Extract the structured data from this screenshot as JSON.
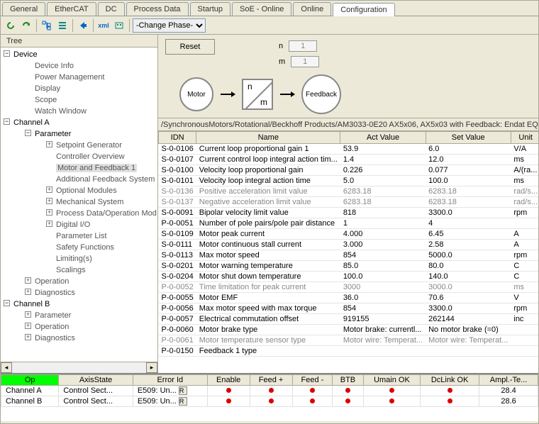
{
  "tabs": [
    "General",
    "EtherCAT",
    "DC",
    "Process Data",
    "Startup",
    "SoE - Online",
    "Online",
    "Configuration"
  ],
  "active_tab": 7,
  "toolbar": {
    "phase_label": "-Change Phase-"
  },
  "tree_title": "Tree",
  "tree": {
    "device": "Device",
    "device_children": [
      "Device Info",
      "Power Management",
      "Display",
      "Scope",
      "Watch Window"
    ],
    "channelA": "Channel A",
    "parameter": "Parameter",
    "param_children": [
      "Setpoint Generator",
      "Controller Overview",
      "Motor and Feedback 1",
      "Additional Feedback System",
      "Optional Modules",
      "Mechanical System",
      "Process Data/Operation Mod",
      "Digital I/O",
      "Parameter List",
      "Safety Functions",
      "Limiting(s)",
      "Scalings"
    ],
    "operation": "Operation",
    "diagnostics": "Diagnostics",
    "channelB": "Channel B",
    "chB_children": [
      "Parameter",
      "Operation",
      "Diagnostics"
    ]
  },
  "right_top": {
    "reset": "Reset",
    "n_label": "n",
    "n_val": "1",
    "m_label": "m",
    "m_val": "1",
    "motor": "Motor",
    "feedback": "Feedback"
  },
  "path": "/SynchronousMotors/Rotational/Beckhoff Products/AM3033-0E20 AX5x06, AX5x03 with Feedback: Endat EQN1125",
  "cols": [
    "IDN",
    "Name",
    "Act Value",
    "Set Value",
    "Unit"
  ],
  "rows": [
    {
      "id": "S-0-0106",
      "name": "Current loop proportional gain 1",
      "act": "53.9",
      "set": "6.0",
      "unit": "V/A",
      "g": 0
    },
    {
      "id": "S-0-0107",
      "name": "Current control loop integral action tim...",
      "act": "1.4",
      "set": "12.0",
      "unit": "ms",
      "g": 0
    },
    {
      "id": "S-0-0100",
      "name": "Velocity loop proportional gain",
      "act": "0.226",
      "set": "0.077",
      "unit": "A/(ra...",
      "g": 0
    },
    {
      "id": "S-0-0101",
      "name": "Velocity loop integral action time",
      "act": "5.0",
      "set": "100.0",
      "unit": "ms",
      "g": 0
    },
    {
      "id": "S-0-0136",
      "name": "Positive acceleration limit value",
      "act": "6283.18",
      "set": "6283.18",
      "unit": "rad/s...",
      "g": 1
    },
    {
      "id": "S-0-0137",
      "name": "Negative acceleration limit value",
      "act": "6283.18",
      "set": "6283.18",
      "unit": "rad/s...",
      "g": 1
    },
    {
      "id": "S-0-0091",
      "name": "Bipolar velocity limit value",
      "act": "818",
      "set": "3300.0",
      "unit": "rpm",
      "g": 0
    },
    {
      "id": "P-0-0051",
      "name": "Number of pole pairs/pole pair distance",
      "act": "1",
      "set": "4",
      "unit": "",
      "g": 0
    },
    {
      "id": "S-0-0109",
      "name": "Motor peak current",
      "act": "4.000",
      "set": "6.45",
      "unit": "A",
      "g": 0
    },
    {
      "id": "S-0-0111",
      "name": "Motor continuous stall current",
      "act": "3.000",
      "set": "2.58",
      "unit": "A",
      "g": 0
    },
    {
      "id": "S-0-0113",
      "name": "Max motor speed",
      "act": "854",
      "set": "5000.0",
      "unit": "rpm",
      "g": 0
    },
    {
      "id": "S-0-0201",
      "name": "Motor warning temperature",
      "act": "85.0",
      "set": "80.0",
      "unit": "C",
      "g": 0
    },
    {
      "id": "S-0-0204",
      "name": "Motor shut down temperature",
      "act": "100.0",
      "set": "140.0",
      "unit": "C",
      "g": 0
    },
    {
      "id": "P-0-0052",
      "name": "Time limitation for peak current",
      "act": "3000",
      "set": "3000.0",
      "unit": "ms",
      "g": 1
    },
    {
      "id": "P-0-0055",
      "name": "Motor EMF",
      "act": "36.0",
      "set": "70.6",
      "unit": "V",
      "g": 0
    },
    {
      "id": "P-0-0056",
      "name": "Max motor speed with max torque",
      "act": "854",
      "set": "3300.0",
      "unit": "rpm",
      "g": 0
    },
    {
      "id": "P-0-0057",
      "name": "Electrical commutation offset",
      "act": "919155",
      "set": "262144",
      "unit": "inc",
      "g": 0
    },
    {
      "id": "P-0-0060",
      "name": "Motor brake type",
      "act": "Motor brake: currentl...",
      "set": "No motor brake (=0)",
      "unit": "",
      "g": 0
    },
    {
      "id": "P-0-0061",
      "name": "Motor temperature sensor type",
      "act": "Motor wire: Temperat...",
      "set": "Motor wire: Temperat...",
      "unit": "",
      "g": 1
    },
    {
      "id": "P-0-0150",
      "name": "Feedback 1 type",
      "act": "",
      "set": "",
      "unit": "",
      "g": 0
    }
  ],
  "status_cols": [
    "Op",
    "AxisState",
    "Error Id",
    "Enable",
    "Feed +",
    "Feed -",
    "BTB",
    "Umain OK",
    "DcLink OK",
    "Ampl.-Te..."
  ],
  "status_rows": [
    {
      "ch": "Channel A",
      "axis": "Control Sect...",
      "err": "E509: Un...",
      "ampl": "28.4"
    },
    {
      "ch": "Channel B",
      "axis": "Control Sect...",
      "err": "E509: Un...",
      "ampl": "28.6"
    }
  ]
}
